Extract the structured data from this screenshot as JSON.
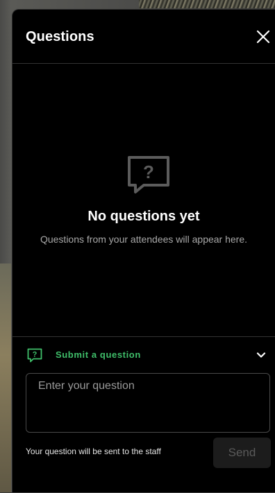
{
  "header": {
    "title": "Questions",
    "close_icon": "close-icon"
  },
  "empty_state": {
    "icon": "question-bubble-icon",
    "title": "No questions yet",
    "subtitle": "Questions from your attendees will appear here."
  },
  "composer": {
    "icon": "question-bubble-icon",
    "label": "Submit a question",
    "expanded": true,
    "chevron_icon": "chevron-down-icon",
    "input_placeholder": "Enter your question",
    "input_value": "",
    "hint": "Your question will be sent to the staff",
    "send_label": "Send",
    "send_enabled": false
  },
  "colors": {
    "panel_bg": "#000000",
    "accent_green": "#3fbf6a",
    "muted_text": "#a8a8a8",
    "send_disabled_bg": "#1c1c1c"
  }
}
